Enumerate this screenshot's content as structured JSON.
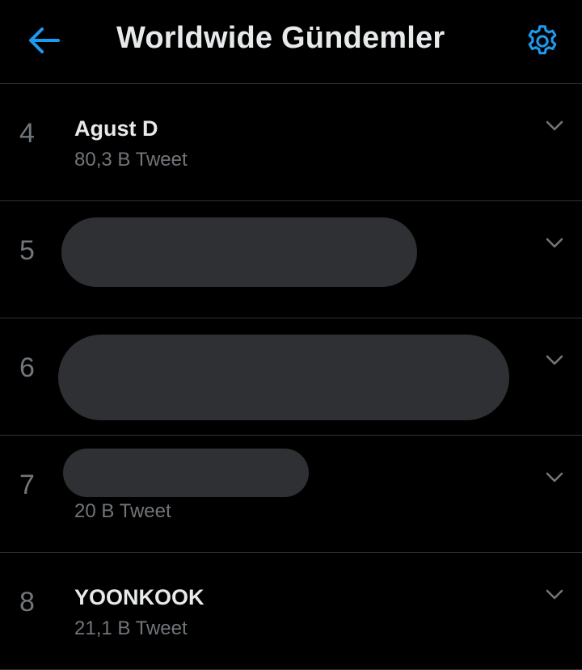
{
  "header": {
    "title": "Worldwide Gündemler",
    "back_icon": "arrow-left-icon",
    "settings_icon": "gear-icon",
    "accent_color": "#1d9bf0"
  },
  "trends": [
    {
      "rank": "4",
      "name": "Agust D",
      "count": "80,3 B Tweet",
      "redacted": false
    },
    {
      "rank": "5",
      "name": "",
      "count": "",
      "redacted": true
    },
    {
      "rank": "6",
      "name": "",
      "count": "",
      "redacted": true
    },
    {
      "rank": "7",
      "name": "",
      "count": "20 B Tweet",
      "redacted": true
    },
    {
      "rank": "8",
      "name": "YOONKOOK",
      "count": "21,1 B Tweet",
      "redacted": false
    }
  ],
  "colors": {
    "background": "#000000",
    "divider": "#2f3336",
    "primary_text": "#e7e9ea",
    "secondary_text": "#71767b",
    "redaction": "#2f3033"
  }
}
